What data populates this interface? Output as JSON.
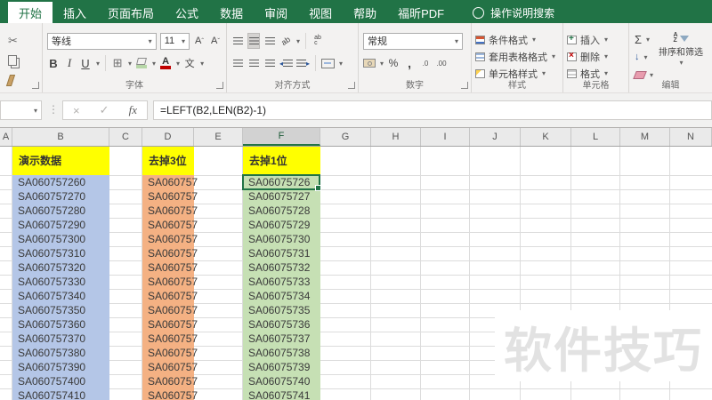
{
  "titlebar": {
    "search_label": "操作说明搜索"
  },
  "tabs": [
    "开始",
    "插入",
    "页面布局",
    "公式",
    "数据",
    "审阅",
    "视图",
    "帮助",
    "福昕PDF"
  ],
  "ribbon": {
    "font_group": {
      "label": "字体",
      "font_name": "等线",
      "font_size": "11",
      "bold": "B",
      "italic": "I",
      "underline": "U",
      "grow": "A",
      "shrink": "A",
      "phonetic": "文"
    },
    "alignment_group": {
      "label": "对齐方式",
      "orientation_icon": "ab",
      "wrap_icon_top": "ab",
      "wrap_icon_bottom": "c"
    },
    "number_group": {
      "label": "数字",
      "format": "常规",
      "percent": "%",
      "comma": ",",
      "dec_inc": ".0",
      "dec_dec": ".00"
    },
    "styles_group": {
      "label": "样式",
      "conditional": "条件格式",
      "format_table": "套用表格格式",
      "cell_styles": "单元格样式"
    },
    "cells_group": {
      "label": "单元格",
      "insert": "插入",
      "delete": "删除",
      "format": "格式"
    },
    "editing_group": {
      "label": "编辑",
      "autosum": "Σ",
      "fill": "↓",
      "sort_a": "A",
      "sort_z": "Z",
      "sort_filter": "排序和筛选"
    }
  },
  "formula_bar": {
    "name_box": "",
    "fx": "fx",
    "formula": "=LEFT(B2,LEN(B2)-1)"
  },
  "grid": {
    "columns": [
      "A",
      "B",
      "C",
      "D",
      "E",
      "F",
      "G",
      "H",
      "I",
      "J",
      "K",
      "L",
      "M",
      "N"
    ],
    "selected_column": "F",
    "header_b": "演示数据",
    "header_d": "去掉3位",
    "header_f": "去掉1位",
    "rows": [
      {
        "b": "SA060757260",
        "d": "SA060757",
        "f": "SA06075726"
      },
      {
        "b": "SA060757270",
        "d": "SA060757",
        "f": "SA06075727"
      },
      {
        "b": "SA060757280",
        "d": "SA060757",
        "f": "SA06075728"
      },
      {
        "b": "SA060757290",
        "d": "SA060757",
        "f": "SA06075729"
      },
      {
        "b": "SA060757300",
        "d": "SA060757",
        "f": "SA06075730"
      },
      {
        "b": "SA060757310",
        "d": "SA060757",
        "f": "SA06075731"
      },
      {
        "b": "SA060757320",
        "d": "SA060757",
        "f": "SA06075732"
      },
      {
        "b": "SA060757330",
        "d": "SA060757",
        "f": "SA06075733"
      },
      {
        "b": "SA060757340",
        "d": "SA060757",
        "f": "SA06075734"
      },
      {
        "b": "SA060757350",
        "d": "SA060757",
        "f": "SA06075735"
      },
      {
        "b": "SA060757360",
        "d": "SA060757",
        "f": "SA06075736"
      },
      {
        "b": "SA060757370",
        "d": "SA060757",
        "f": "SA06075737"
      },
      {
        "b": "SA060757380",
        "d": "SA060757",
        "f": "SA06075738"
      },
      {
        "b": "SA060757390",
        "d": "SA060757",
        "f": "SA06075739"
      },
      {
        "b": "SA060757400",
        "d": "SA060757",
        "f": "SA06075740"
      },
      {
        "b": "SA060757410",
        "d": "SA060757",
        "f": "SA06075741"
      }
    ]
  },
  "watermark": "软件技巧",
  "colors": {
    "brand_green": "#217346",
    "header_yellow": "#ffff00",
    "col_b_blue": "#b4c6e7",
    "col_d_orange": "#f4b183",
    "col_f_green": "#c6e0b4"
  }
}
